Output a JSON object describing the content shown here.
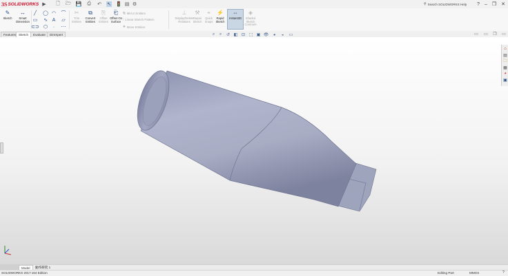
{
  "app": {
    "brand_prefix": "3S",
    "brand": "SOLIDWORKS"
  },
  "search": {
    "placeholder": "Search SOLIDWORKS Help"
  },
  "window_controls": {
    "help": "?",
    "minimize": "–",
    "restore": "❐",
    "close": "✕"
  },
  "ribbon": {
    "sketch": "Sketch",
    "smart_dimension": "Smart Dimension",
    "trim_entities": "Trim Entities",
    "convert_entities": "Convert Entities",
    "offset_entities": "Offset Entities",
    "offset_on_surface": "Offset On Surface",
    "mirror_entities": "Mirror Entities",
    "linear_sketch_pattern": "Linear Sketch Pattern",
    "move_entities": "Move Entities",
    "display_delete_relations": "Display/Delete Relations",
    "repair_sketch": "Repair Sketch",
    "quick_snaps": "Quick Snaps",
    "rapid_sketch": "Rapid Sketch",
    "instant2d": "Instant2D",
    "shaded_sketch_contours": "Shaded Sketch Contours"
  },
  "tabs": [
    "Features",
    "Sketch",
    "Evaluate",
    "DimXpert"
  ],
  "active_tab": "Sketch",
  "model_tabs": [
    "Model",
    "動作研究 1"
  ],
  "status": {
    "version": "SOLIDWORKS 2017 x64 Edition",
    "mode": "Editing Part",
    "units": "MMGS"
  },
  "colors": {
    "brand_red": "#d0112b",
    "part_body": "#a7acc6",
    "viewport_top": "#ffffff",
    "viewport_bottom": "#d9d9d9"
  }
}
